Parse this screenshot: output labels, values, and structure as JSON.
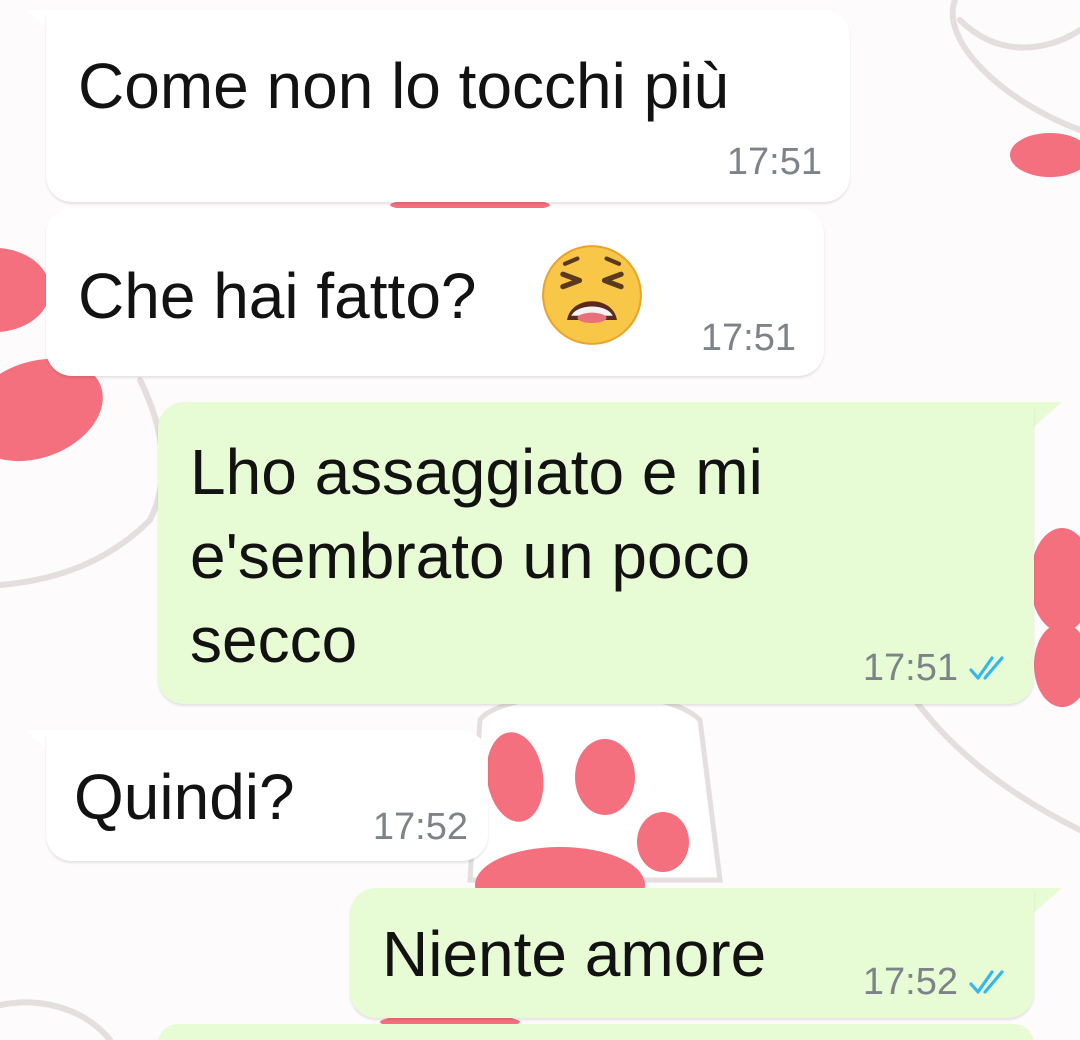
{
  "colors": {
    "incoming_bubble": "#ffffff",
    "outgoing_bubble": "#e7fcd4",
    "message_text": "#121212",
    "timestamp": "#7d8389",
    "read_receipt": "#34b7f1",
    "wallpaper_paw": "#f4707e"
  },
  "chat": {
    "messages": [
      {
        "direction": "incoming",
        "text": "Come non lo tocchi più",
        "time": "17:51"
      },
      {
        "direction": "incoming",
        "text": "Che hai fatto?",
        "emoji": "tired-face",
        "time": "17:51"
      },
      {
        "direction": "outgoing",
        "lines": [
          "Lho assaggiato e mi",
          "e'sembrato un poco",
          "secco"
        ],
        "time": "17:51",
        "status": "read"
      },
      {
        "direction": "incoming",
        "text": "Quindi?",
        "time": "17:52"
      },
      {
        "direction": "outgoing",
        "text": "Niente amore",
        "time": "17:52",
        "status": "read"
      }
    ]
  }
}
